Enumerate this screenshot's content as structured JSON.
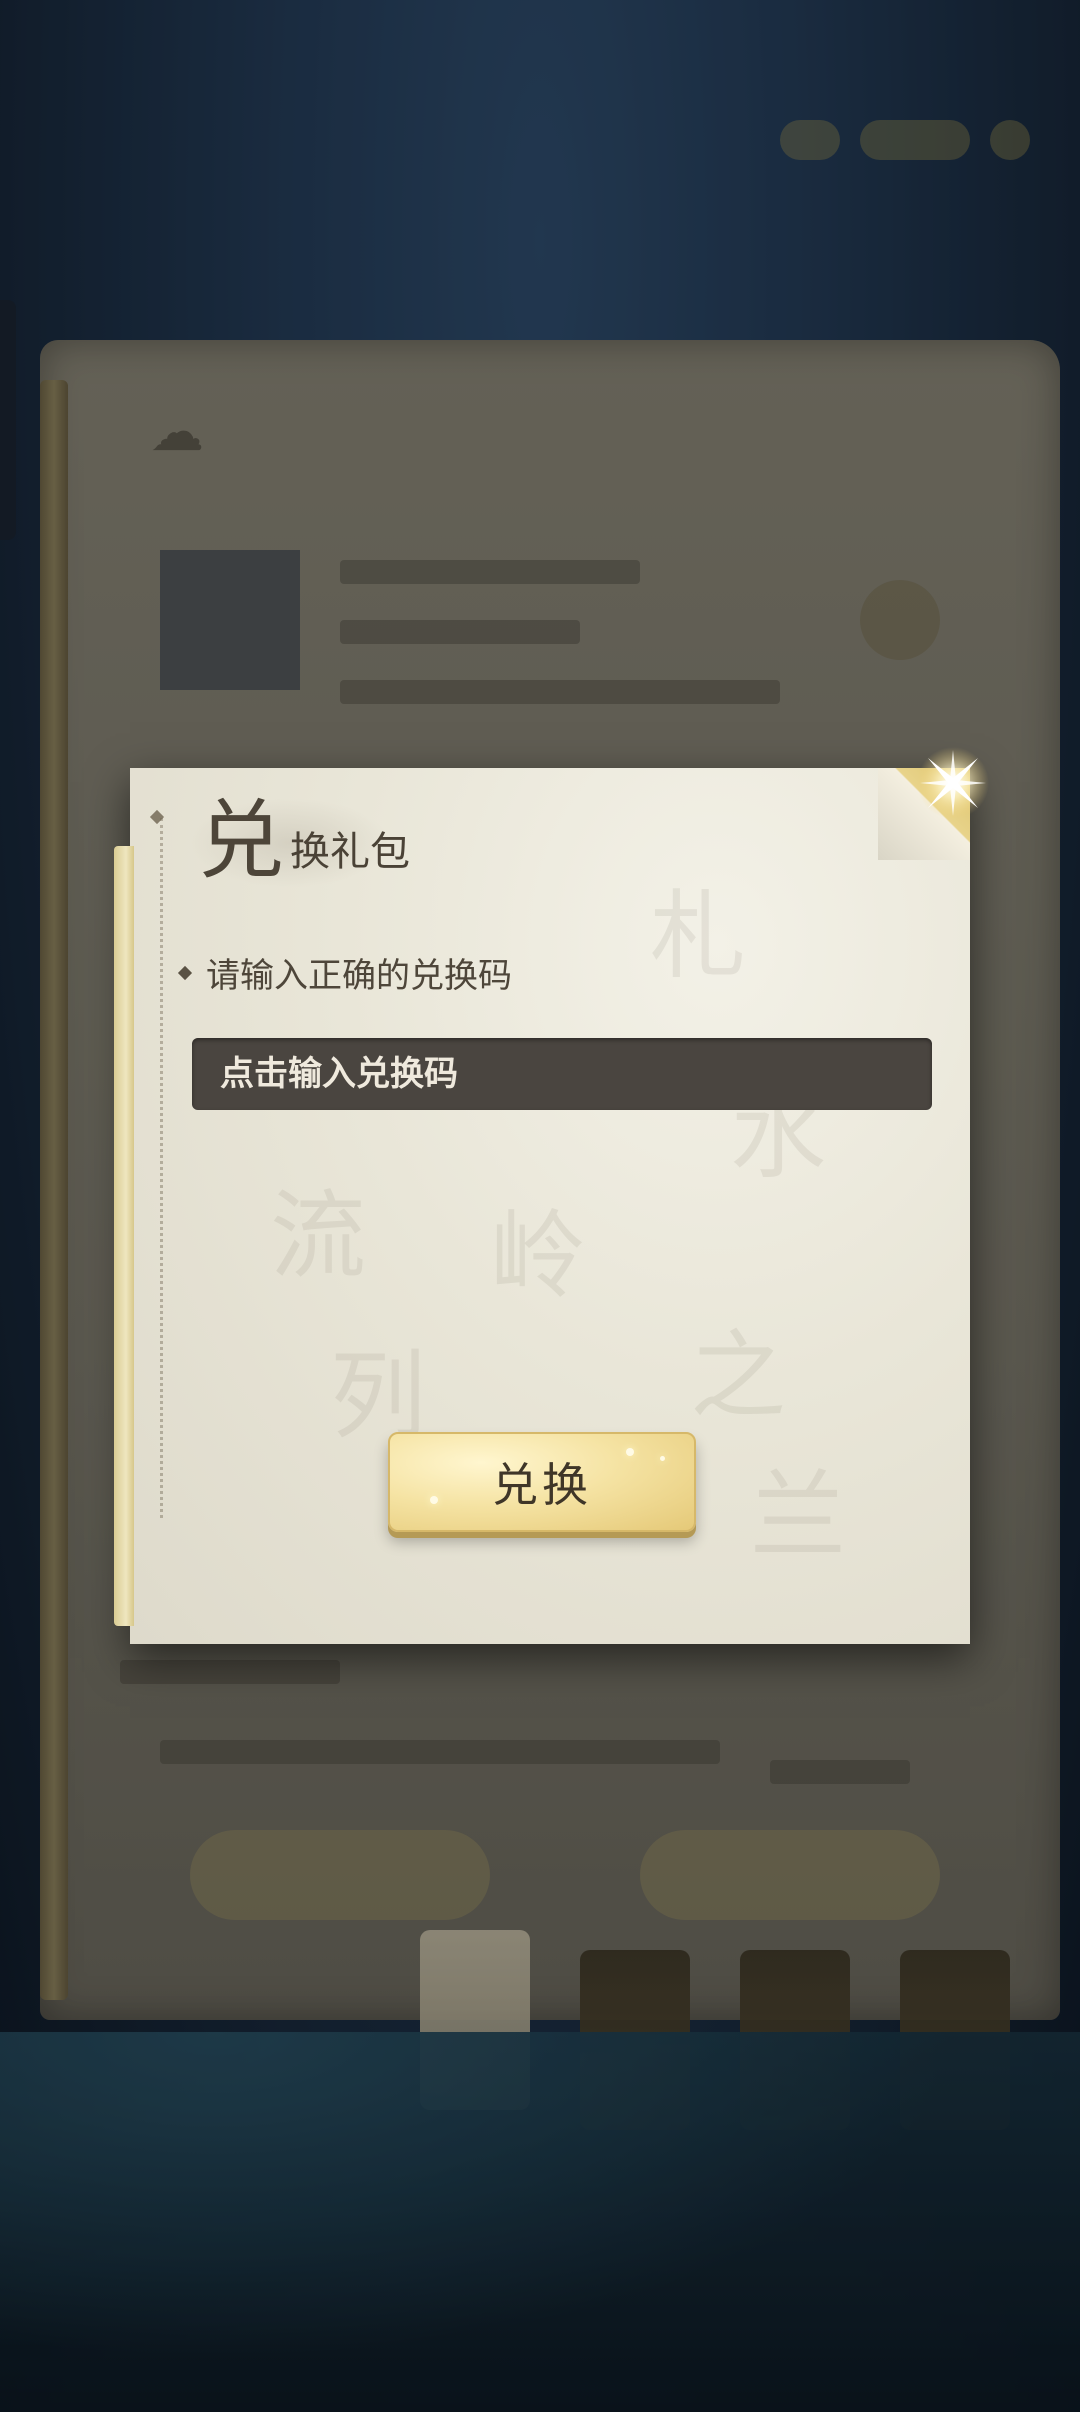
{
  "dialog": {
    "title_first_char": "兑",
    "title_rest": "换礼包",
    "hint": "请输入正确的兑换码",
    "input_placeholder": "点击输入兑换码",
    "input_value": "",
    "redeem_label": "兑换"
  },
  "colors": {
    "dialog_paper": "#ebe8db",
    "input_bg": "#4a4540",
    "button_gold": "#f5e3a3",
    "title_text": "#4a4236"
  },
  "icons": {
    "close": "close-sparkle-icon",
    "bullet": "diamond-bullet-icon"
  }
}
